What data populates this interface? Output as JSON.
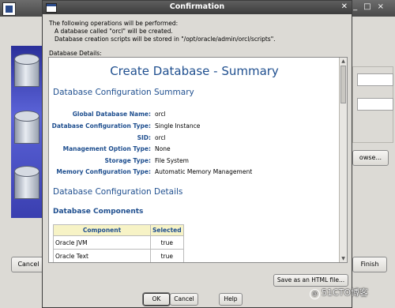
{
  "background": {
    "buttons": {
      "cancel": "Cancel",
      "browse": "owse...",
      "finish": "Finish"
    }
  },
  "dialog": {
    "title": "Confirmation",
    "intro": {
      "line1": "The following operations will be performed:",
      "line2": "A database called \"orcl\" will be created.",
      "line3": "Database creation scripts will be stored in \"/opt/oracle/admin/orcl/scripts\"."
    },
    "details_label": "Database Details:",
    "summary": {
      "title": "Create Database - Summary",
      "section1": "Database Configuration Summary",
      "fields": [
        {
          "key": "Global Database Name:",
          "value": "orcl"
        },
        {
          "key": "Database Configuration Type:",
          "value": "Single Instance"
        },
        {
          "key": "SID:",
          "value": "orcl"
        },
        {
          "key": "Management Option Type:",
          "value": "None"
        },
        {
          "key": "Storage Type:",
          "value": "File System"
        },
        {
          "key": "Memory Configuration Type:",
          "value": "Automatic Memory Management"
        }
      ],
      "section2": "Database Configuration Details",
      "subsection": "Database Components",
      "table": {
        "headers": [
          "Component",
          "Selected"
        ],
        "rows": [
          [
            "Oracle JVM",
            "true"
          ],
          [
            "Oracle Text",
            "true"
          ]
        ]
      }
    },
    "buttons": {
      "save_html": "Save as an HTML file...",
      "ok": "OK",
      "cancel": "Cancel",
      "help": "Help"
    }
  },
  "watermark": {
    "symbol": "@",
    "text": "51CTO博客"
  },
  "colors": {
    "heading": "#1f4f8f",
    "table_header_bg": "#f7f3c6",
    "titlebar": "#4a4a4a"
  }
}
